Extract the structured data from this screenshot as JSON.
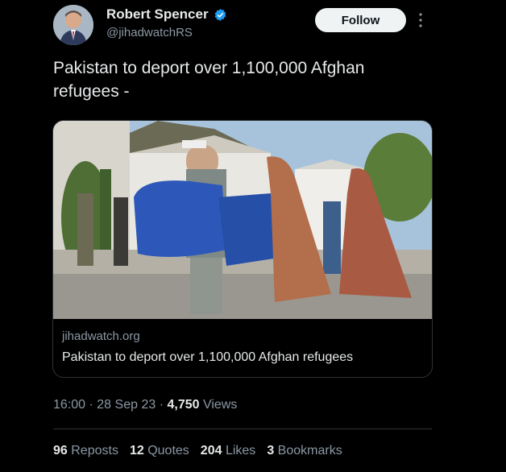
{
  "author": {
    "name": "Robert Spencer",
    "handle": "@jihadwatchRS",
    "verified_color": "#1d9bf0"
  },
  "follow_label": "Follow",
  "tweet_text": "Pakistan to deport over 1,100,000 Afghan refugees -",
  "card": {
    "domain": "jihadwatch.org",
    "title": "Pakistan to deport over 1,100,000 Afghan refugees"
  },
  "meta": {
    "time": "16:00",
    "date": "28 Sep 23",
    "views_count": "4,750",
    "views_label": "Views"
  },
  "stats": {
    "reposts_count": "96",
    "reposts_label": "Reposts",
    "quotes_count": "12",
    "quotes_label": "Quotes",
    "likes_count": "204",
    "likes_label": "Likes",
    "bookmarks_count": "3",
    "bookmarks_label": "Bookmarks"
  }
}
